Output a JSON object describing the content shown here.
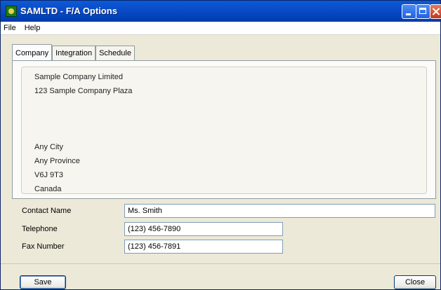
{
  "window": {
    "title": "SAMLTD - F/A Options",
    "icon": "app-icon",
    "controls": [
      "minimize-icon",
      "maximize-icon",
      "close-icon"
    ]
  },
  "menu": {
    "items": [
      "File",
      "Help"
    ]
  },
  "tabs": [
    {
      "label": "Company",
      "active": true
    },
    {
      "label": "Integration",
      "active": false
    },
    {
      "label": "Schedule",
      "active": false
    }
  ],
  "address": {
    "lines": [
      "Sample Company Limited",
      "123 Sample Company Plaza",
      "",
      "",
      "",
      "Any City",
      "Any Province",
      "V6J 9T3",
      "Canada"
    ]
  },
  "fields": {
    "contact": {
      "label": "Contact Name",
      "value": "Ms. Smith"
    },
    "telephone": {
      "label": "Telephone",
      "value": "(123) 456-7890"
    },
    "fax": {
      "label": "Fax Number",
      "value": "(123) 456-7891"
    }
  },
  "buttons": {
    "save": "Save",
    "close": "Close"
  }
}
